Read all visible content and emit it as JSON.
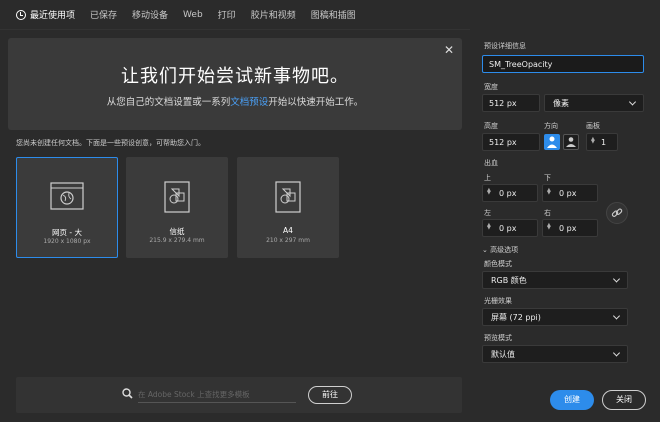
{
  "tabs": [
    {
      "label": "最近使用项",
      "active": true
    },
    {
      "label": "已保存"
    },
    {
      "label": "移动设备"
    },
    {
      "label": "Web"
    },
    {
      "label": "打印"
    },
    {
      "label": "胶片和视频"
    },
    {
      "label": "图稿和插图"
    }
  ],
  "banner": {
    "title": "让我们开始尝试新事物吧。",
    "sub_before": "从您自己的文档设置或一系列",
    "sub_link": "文档预设",
    "sub_after": "开始以快速开始工作。"
  },
  "hint": "您尚未创建任何文档。下面是一些预设创意，可帮助您入门。",
  "presets": [
    {
      "name": "网页 - 大",
      "size": "1920 x 1080 px"
    },
    {
      "name": "信纸",
      "size": "215.9 x 279.4 mm"
    },
    {
      "name": "A4",
      "size": "210 x 297 mm"
    }
  ],
  "search": {
    "placeholder": "在 Adobe Stock 上查找更多模板",
    "go_label": "前往"
  },
  "details": {
    "section_label": "预设详细信息",
    "name_value": "SM_TreeOpacity",
    "width_label": "宽度",
    "width_value": "512 px",
    "unit_value": "像素",
    "height_label": "高度",
    "height_value": "512 px",
    "orientation_label": "方向",
    "artboard_label": "画板",
    "artboard_value": "1",
    "bleed_label": "出血",
    "top_label": "上",
    "top_value": "0 px",
    "bottom_label": "下",
    "bottom_value": "0 px",
    "left_label": "左",
    "left_value": "0 px",
    "right_label": "右",
    "right_value": "0 px",
    "advanced_label": "高级选项",
    "color_mode_label": "颜色模式",
    "color_mode_value": "RGB 颜色",
    "raster_label": "光栅效果",
    "raster_value": "屏幕 (72 ppi)",
    "preview_label": "预览模式",
    "preview_value": "默认值",
    "create_label": "创建",
    "close_label": "关闭"
  },
  "colors": {
    "accent": "#2d8ceb",
    "bg": "#2b2b2b",
    "card": "#3b3b3b"
  }
}
